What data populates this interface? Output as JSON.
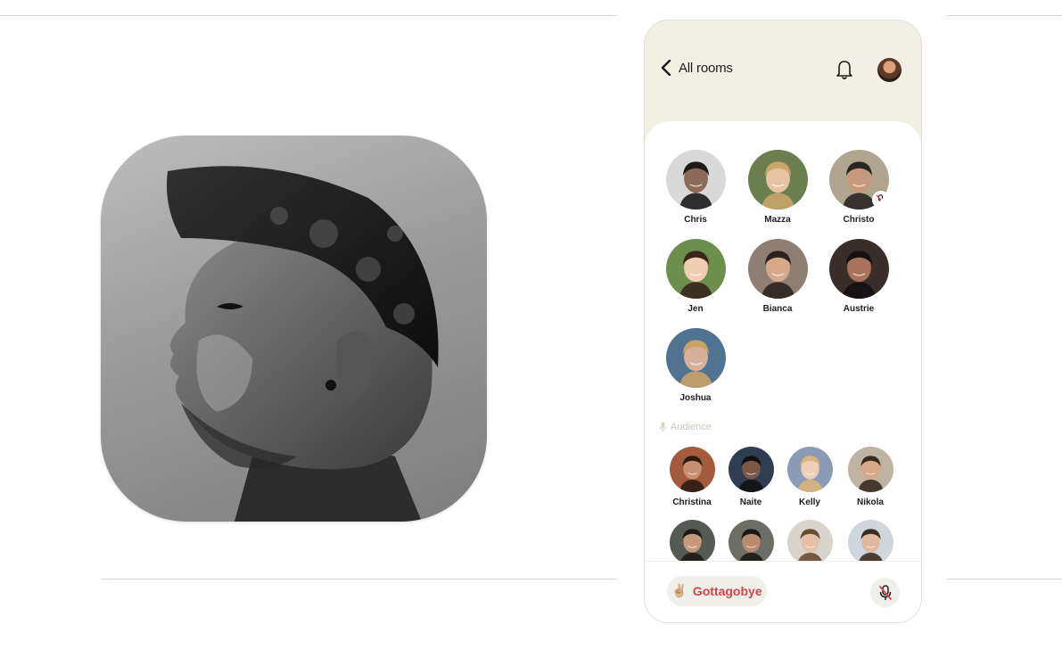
{
  "topbar": {
    "back_label": "All rooms",
    "back_icon": "chevron-left-icon",
    "notifications_icon": "bell-icon",
    "profile_icon": "avatar"
  },
  "speakers": [
    {
      "name": "Chris",
      "muted": false,
      "skin": "#8c6a57",
      "bg": "#d9d9d9",
      "hair": "#1b1b1b"
    },
    {
      "name": "Mazza",
      "muted": false,
      "skin": "#e7c3a6",
      "bg": "#6b7f4e",
      "hair": "#c9a56a"
    },
    {
      "name": "Christo",
      "muted": true,
      "skin": "#c79a7d",
      "bg": "#b0a690",
      "hair": "#2a2622"
    },
    {
      "name": "Jen",
      "muted": false,
      "skin": "#f0cdb3",
      "bg": "#6c8f4e",
      "hair": "#3a261c"
    },
    {
      "name": "Bianca",
      "muted": false,
      "skin": "#d6a98a",
      "bg": "#8e7f72",
      "hair": "#2b2320"
    },
    {
      "name": "Austrie",
      "muted": false,
      "skin": "#a8735a",
      "bg": "#3a2e2a",
      "hair": "#141012"
    },
    {
      "name": "Joshua",
      "muted": false,
      "skin": "#d8b09a",
      "bg": "#4f7391",
      "hair": "#c8a266"
    }
  ],
  "audience_label": "Audience",
  "audience": [
    {
      "name": "Christina",
      "skin": "#c79070",
      "bg": "#a45b3d",
      "hair": "#2d1c14"
    },
    {
      "name": "Naite",
      "skin": "#7d5846",
      "bg": "#2f3d52",
      "hair": "#111111"
    },
    {
      "name": "Kelly",
      "skin": "#efcfb8",
      "bg": "#8b9bb5",
      "hair": "#d8b57a"
    },
    {
      "name": "Nikola",
      "skin": "#d8a789",
      "bg": "#bfb3a3",
      "hair": "#3a2a20"
    },
    {
      "name": "",
      "skin": "#c8987a",
      "bg": "#565a54",
      "hair": "#1e1a18"
    },
    {
      "name": "",
      "skin": "#b98a6e",
      "bg": "#6d6e66",
      "hair": "#1a1816"
    },
    {
      "name": "",
      "skin": "#e4c0a8",
      "bg": "#d8d4cc",
      "hair": "#6b4a34"
    },
    {
      "name": "",
      "skin": "#e0b89c",
      "bg": "#cfd6dc",
      "hair": "#3b2c22"
    }
  ],
  "footer": {
    "leave_emoji": "✌🏼",
    "leave_label": "Gottagobye",
    "mic_icon": "mic-muted-icon"
  },
  "colors": {
    "sheet_bg": "#f2efe5",
    "leave_text": "#d0464b",
    "mute_red": "#e0424a"
  }
}
